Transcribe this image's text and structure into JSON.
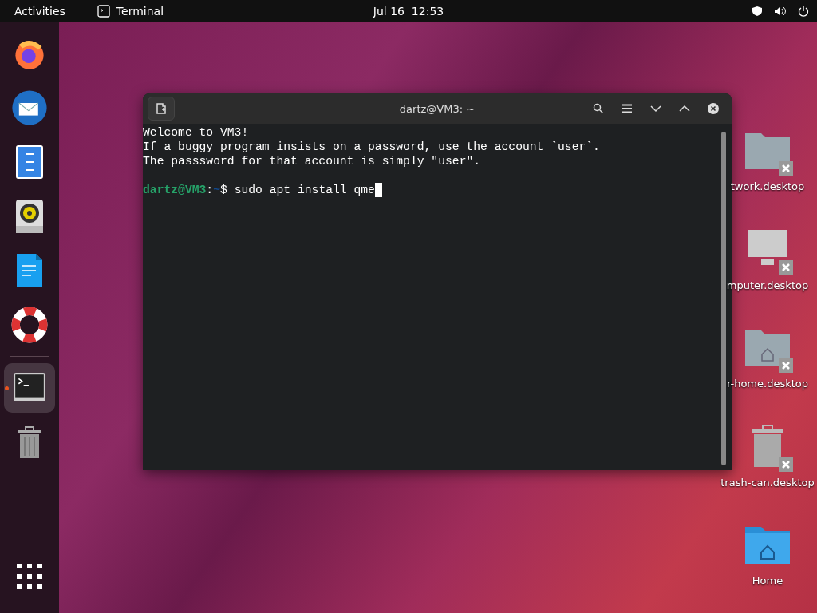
{
  "top_bar": {
    "activities": "Activities",
    "app_name": "Terminal",
    "clock": "Jul 16  12:53"
  },
  "dock": {
    "items": [
      {
        "kind": "firefox",
        "selected": false
      },
      {
        "kind": "mail",
        "selected": false
      },
      {
        "kind": "files",
        "selected": false
      },
      {
        "kind": "speaker",
        "selected": false
      },
      {
        "kind": "writer",
        "selected": false
      },
      {
        "kind": "help",
        "selected": false
      },
      {
        "kind": "terminal",
        "selected": true
      },
      {
        "kind": "trash",
        "selected": false
      }
    ]
  },
  "terminal": {
    "title": "dartz@VM3: ~",
    "lines": [
      "Welcome to VM3!",
      "If a buggy program insists on a password, use the account `user`.",
      "The passsword for that account is simply \"user\"."
    ],
    "prompt": {
      "user": "dartz@VM3",
      "separator": ":",
      "path": "~",
      "symbol": "$",
      "command": "sudo apt install qme"
    }
  },
  "desktop_icons": [
    {
      "label": "twork.desktop",
      "kind": "folder",
      "broken": true
    },
    {
      "label": "mputer.desktop",
      "kind": "computer",
      "broken": true
    },
    {
      "label": "r-home.desktop",
      "kind": "home-folder",
      "broken": true
    },
    {
      "label": "trash-can.desktop",
      "kind": "trash",
      "broken": true
    },
    {
      "label": "Home",
      "kind": "home",
      "broken": false
    }
  ]
}
